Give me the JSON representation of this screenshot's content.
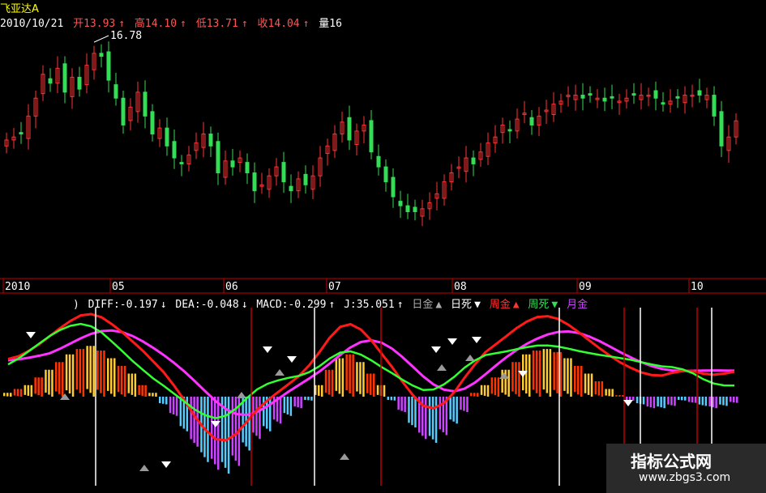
{
  "header": {
    "stock_name": "飞亚达A",
    "date": "2010/10/21",
    "open_label": "开13.93",
    "high_label": "高14.10",
    "low_label": "低13.71",
    "close_label": "收14.04",
    "volume_label": "量16",
    "max_price_label": "16.78"
  },
  "indicator": {
    "prefix": ")",
    "diff": "DIFF:-0.197",
    "dea": "DEA:-0.048",
    "macd": "MACD:-0.299",
    "j": "J:35.051",
    "day_gold": "日金",
    "day_death": "日死",
    "week_gold": "周金",
    "week_death": "周死",
    "month_gold": "月金"
  },
  "watermark": {
    "title": "指标公式网",
    "url": "www.zbgs3.com"
  },
  "colors": {
    "up": "#ff3333",
    "down": "#33dd55",
    "axis": "#c00000",
    "diff": "#ff1a1a",
    "dea": "#ff33ff",
    "j": "#33ff33",
    "white_line": "#ffffff",
    "hist_pos_red": "#ff3300",
    "hist_pos_yellow": "#ffcc33",
    "hist_neg_purple": "#cc44ff",
    "hist_neg_blue": "#55ccff"
  },
  "chart_data": [
    {
      "type": "candlestick",
      "title": "飞亚达A",
      "x_tick_labels": [
        "2010",
        "05",
        "06",
        "07",
        "08",
        "09",
        "10"
      ],
      "max_label": 16.78,
      "last_ohlc": {
        "open": 13.93,
        "high": 14.1,
        "low": 13.71,
        "close": 14.04
      },
      "close_profile": [
        13.4,
        13.5,
        13.6,
        14.2,
        14.8,
        15.6,
        15.3,
        15.8,
        15.0,
        15.5,
        15.1,
        15.9,
        16.3,
        16.2,
        15.4,
        14.8,
        13.9,
        14.5,
        15.0,
        14.2,
        13.6,
        13.8,
        13.2,
        12.8,
        12.6,
        12.9,
        13.3,
        13.6,
        13.2,
        12.3,
        12.7,
        12.5,
        12.8,
        12.3,
        11.7,
        11.9,
        12.2,
        12.5,
        12.0,
        11.7,
        12.1,
        11.9,
        12.2,
        12.8,
        13.2,
        13.6,
        14.0,
        13.4,
        13.7,
        13.9,
        13.0,
        12.5,
        12.0,
        11.5,
        11.2,
        11.0,
        11.0,
        11.1,
        11.3,
        11.6,
        12.0,
        12.3,
        12.5,
        12.8,
        12.6,
        13.0,
        13.3,
        13.5,
        13.9,
        13.7,
        14.1,
        14.3,
        13.9,
        14.2,
        14.4,
        14.6,
        14.7,
        14.9,
        14.9,
        14.8,
        14.9,
        14.8,
        14.7,
        14.8,
        14.7,
        14.8,
        14.9,
        14.9,
        14.9,
        14.8,
        14.6,
        14.7,
        14.8,
        14.9,
        14.9,
        14.9,
        14.9,
        14.2,
        13.2,
        13.5,
        14.04
      ]
    },
    {
      "type": "macd",
      "series": [
        {
          "name": "DIFF",
          "last_value": -0.197
        },
        {
          "name": "DEA",
          "last_value": -0.048
        },
        {
          "name": "MACD",
          "last_value": -0.299
        },
        {
          "name": "J",
          "last_value": 35.051
        }
      ],
      "histogram_profile": [
        0.05,
        0.1,
        0.15,
        0.25,
        0.35,
        0.45,
        0.55,
        0.62,
        0.66,
        0.6,
        0.5,
        0.4,
        0.3,
        0.15,
        0.05,
        -0.1,
        -0.25,
        -0.45,
        -0.65,
        -0.85,
        -0.95,
        -1.0,
        -0.9,
        -0.7,
        -0.55,
        -0.45,
        -0.35,
        -0.25,
        -0.15,
        -0.05,
        0.15,
        0.35,
        0.5,
        0.55,
        0.45,
        0.3,
        0.15,
        -0.05,
        -0.2,
        -0.4,
        -0.55,
        -0.6,
        -0.5,
        -0.35,
        -0.2,
        0.05,
        0.15,
        0.25,
        0.35,
        0.45,
        0.55,
        0.6,
        0.62,
        0.58,
        0.5,
        0.4,
        0.3,
        0.2,
        0.1,
        0.02,
        -0.05,
        -0.1,
        -0.15,
        -0.15,
        -0.12,
        -0.05,
        -0.08,
        -0.12,
        -0.15,
        -0.12,
        -0.08
      ]
    }
  ]
}
